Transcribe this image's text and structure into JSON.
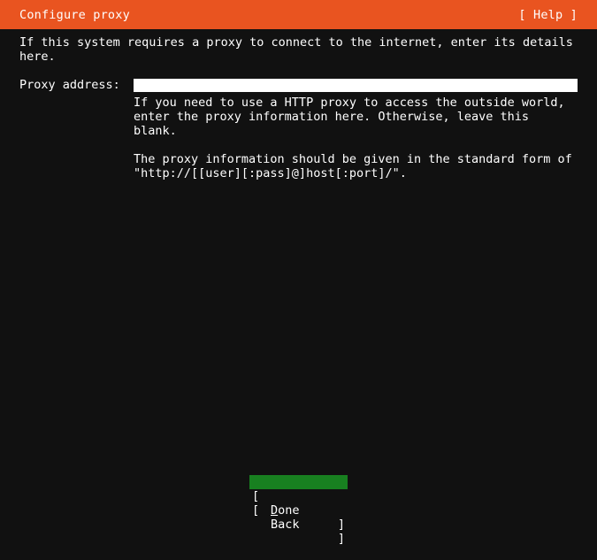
{
  "header": {
    "title": "Configure proxy",
    "help_label": "[ Help ]",
    "background_color": "#e95420",
    "text_color": "#ffffff"
  },
  "screen": {
    "background_color": "#111111",
    "text_color": "#ffffff"
  },
  "main": {
    "intro": "If this system requires a proxy to connect to the internet, enter its details here.",
    "field": {
      "label": "Proxy address:",
      "value": "",
      "placeholder": ""
    },
    "help_paragraphs": [
      "If you need to use a HTTP proxy to access the outside world, enter the proxy information here. Otherwise, leave this blank.",
      "The proxy information should be given in the standard form of \"http://[[user][:pass]@]host[:port]/\"."
    ]
  },
  "buttons": {
    "selected_color": "#188020",
    "done": {
      "bracket_left": "[",
      "bracket_right": "]",
      "accel": "D",
      "rest": "one"
    },
    "back": {
      "bracket_left": "[",
      "bracket_right": "]",
      "label": "Back"
    }
  }
}
